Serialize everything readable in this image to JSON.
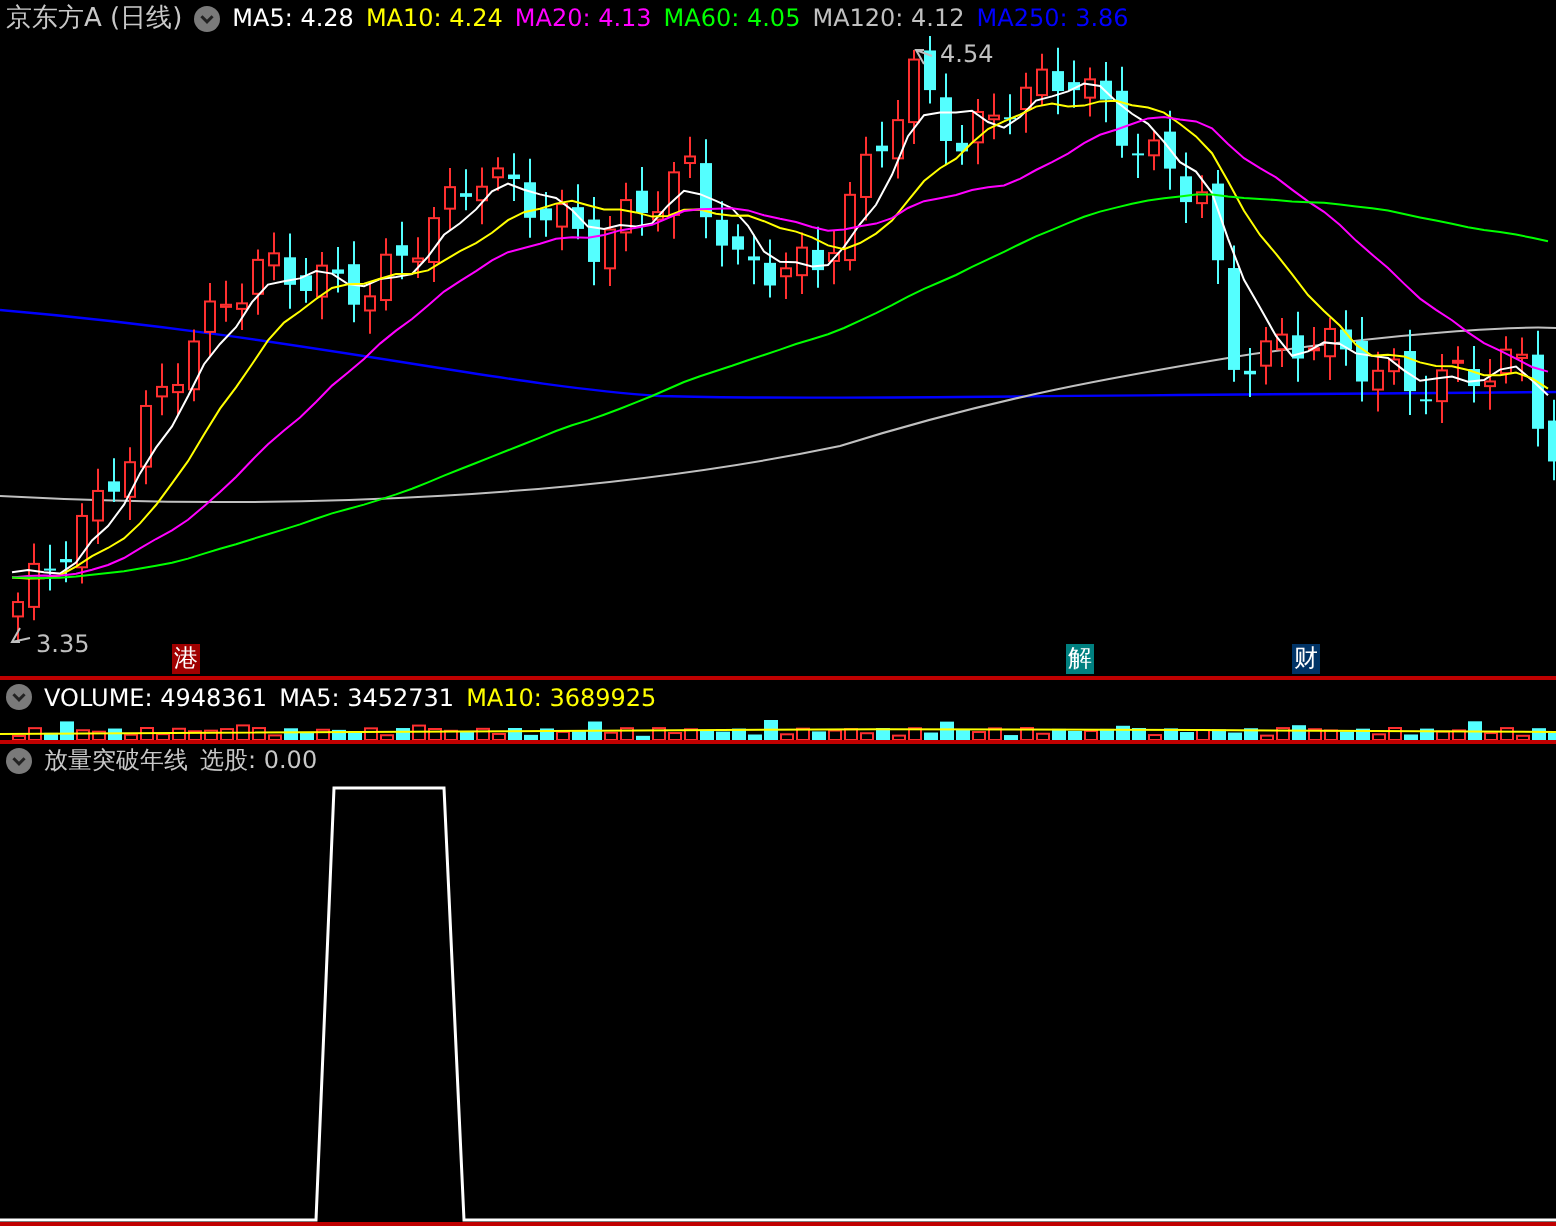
{
  "header": {
    "title": "京东方A (日线)",
    "indicators": [
      {
        "label": "MA5: 4.28",
        "color": "#ffffff"
      },
      {
        "label": "MA10: 4.24",
        "color": "#ffff00"
      },
      {
        "label": "MA20: 4.13",
        "color": "#ff00ff"
      },
      {
        "label": "MA60: 4.05",
        "color": "#00ff00"
      },
      {
        "label": "MA120: 4.12",
        "color": "#c0c0c0"
      },
      {
        "label": "MA250: 3.86",
        "color": "#0000ff"
      }
    ]
  },
  "price_labels": {
    "high": "4.54",
    "low": "3.35"
  },
  "events": [
    {
      "label": "港",
      "color": "#a00000"
    },
    {
      "label": "解",
      "color": "#008080"
    },
    {
      "label": "财",
      "color": "#003366"
    }
  ],
  "volume_panel": {
    "items": [
      {
        "label": "VOLUME: 4948361",
        "color": "#ffffff"
      },
      {
        "label": "MA5: 3452731",
        "color": "#ffffff"
      },
      {
        "label": "MA10: 3689925",
        "color": "#ffff00"
      }
    ]
  },
  "indicator_panel": {
    "title": "放量突破年线",
    "reading": "选股: 0.00"
  }
}
